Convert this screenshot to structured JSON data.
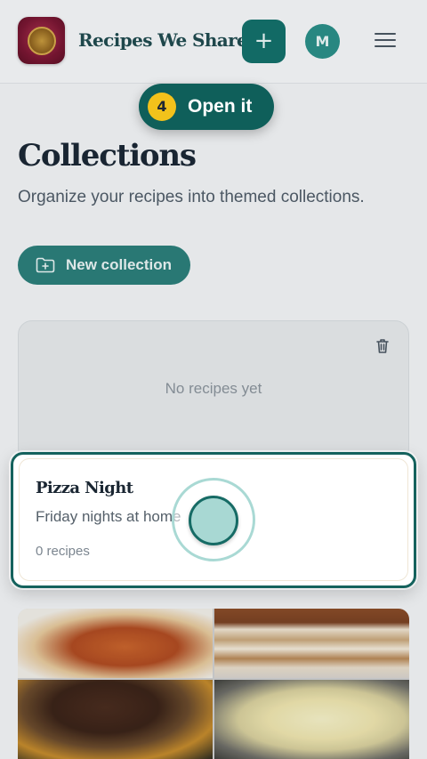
{
  "header": {
    "app_title": "Recipes We Share",
    "add_button_label": "+",
    "avatar_initial": "M"
  },
  "tour": {
    "step_number": "4",
    "step_text": "Open it"
  },
  "main": {
    "title": "Collections",
    "subtitle": "Organize your recipes into themed collections.",
    "new_collection_label": "New collection"
  },
  "collections": [
    {
      "empty_text": "No recipes yet"
    },
    {
      "name": "Pizza Night",
      "description": "Friday nights at home",
      "count": "0 recipes"
    }
  ],
  "colors": {
    "brand_teal": "#136f69",
    "highlight_border": "#15625d",
    "step_badge": "#f2c21b"
  },
  "icons": [
    "app-logo",
    "plus-icon",
    "menu-icon",
    "folder-plus-icon",
    "trash-icon",
    "tap-indicator"
  ]
}
